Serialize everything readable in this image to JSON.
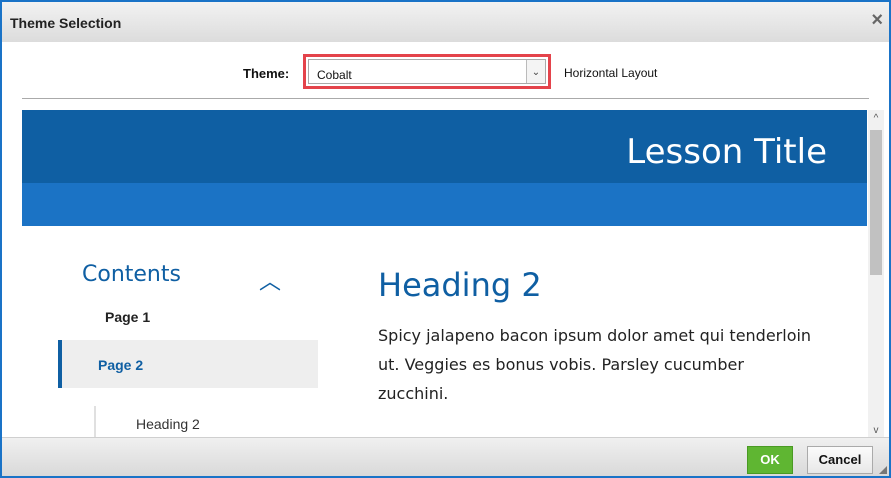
{
  "dialog": {
    "title": "Theme Selection",
    "close_glyph": "×"
  },
  "theme_row": {
    "label": "Theme:",
    "selected": "Cobalt",
    "arrow_glyph": "⌄",
    "layout_label": "Horizontal Layout"
  },
  "preview": {
    "lesson_title": "Lesson Title",
    "contents_title": "Contents",
    "chevron_glyph": "︿",
    "nav_items": [
      "Page 1",
      "Page 2"
    ],
    "sub_item": "Heading 2",
    "heading": "Heading 2",
    "body": "Spicy jalapeno bacon ipsum dolor amet qui tenderloin ut. Veggies es bonus vobis. Parsley cucumber zucchini."
  },
  "scrollbar": {
    "up_glyph": "^",
    "down_glyph": "v"
  },
  "footer": {
    "ok_label": "OK",
    "cancel_label": "Cancel"
  },
  "colors": {
    "border": "#1a73c7",
    "banner": "#0f5fa3",
    "subbanner": "#1b73c5",
    "highlight": "#e4434b",
    "ok": "#5fb632"
  }
}
